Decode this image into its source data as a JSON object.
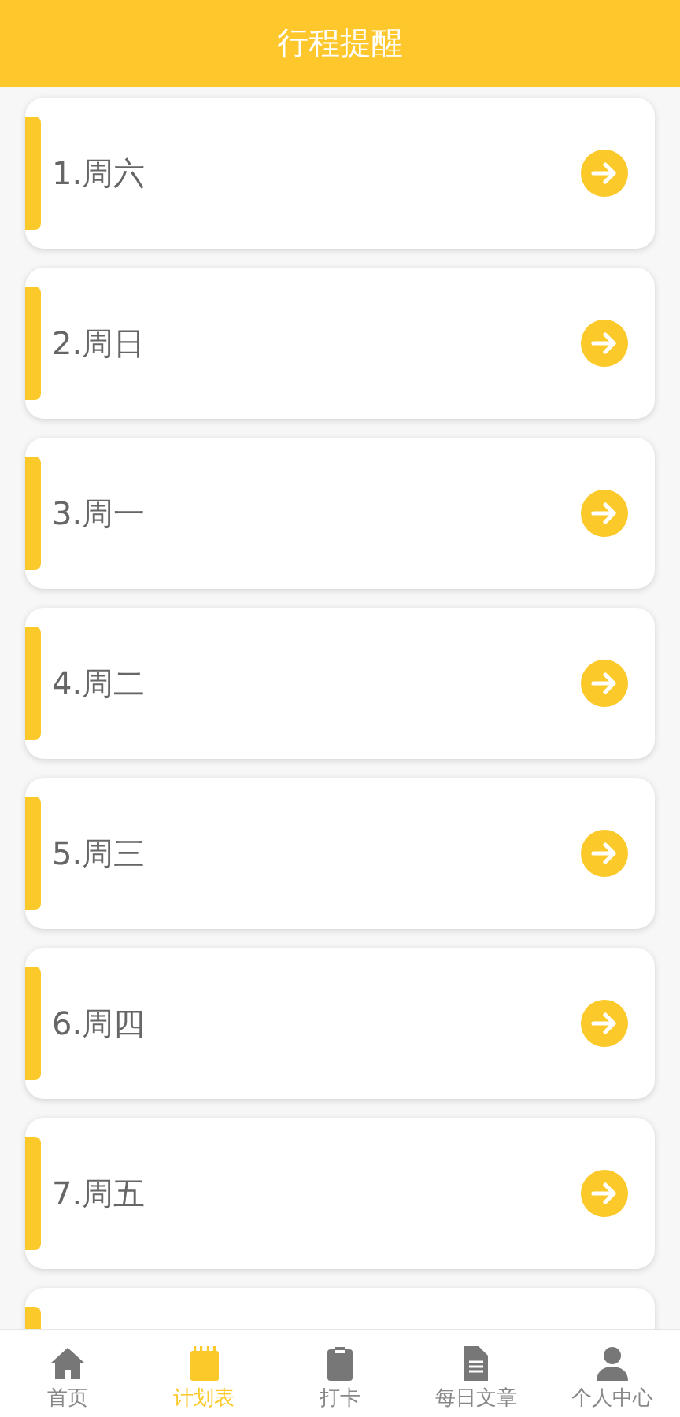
{
  "header": {
    "title": "行程提醒"
  },
  "schedule": {
    "more_below": true,
    "items": [
      {
        "label": "1.周六"
      },
      {
        "label": "2.周日"
      },
      {
        "label": "3.周一"
      },
      {
        "label": "4.周二"
      },
      {
        "label": "5.周三"
      },
      {
        "label": "6.周四"
      },
      {
        "label": "7.周五"
      }
    ]
  },
  "tab_bar": [
    {
      "kind": "home",
      "label": "首页",
      "selected": false
    },
    {
      "kind": "notepad",
      "label": "计划表",
      "selected": true
    },
    {
      "kind": "clipboard",
      "label": "打卡",
      "selected": false
    },
    {
      "kind": "document",
      "label": "每日文章",
      "selected": false
    },
    {
      "kind": "person",
      "label": "个人中心",
      "selected": false
    }
  ]
}
